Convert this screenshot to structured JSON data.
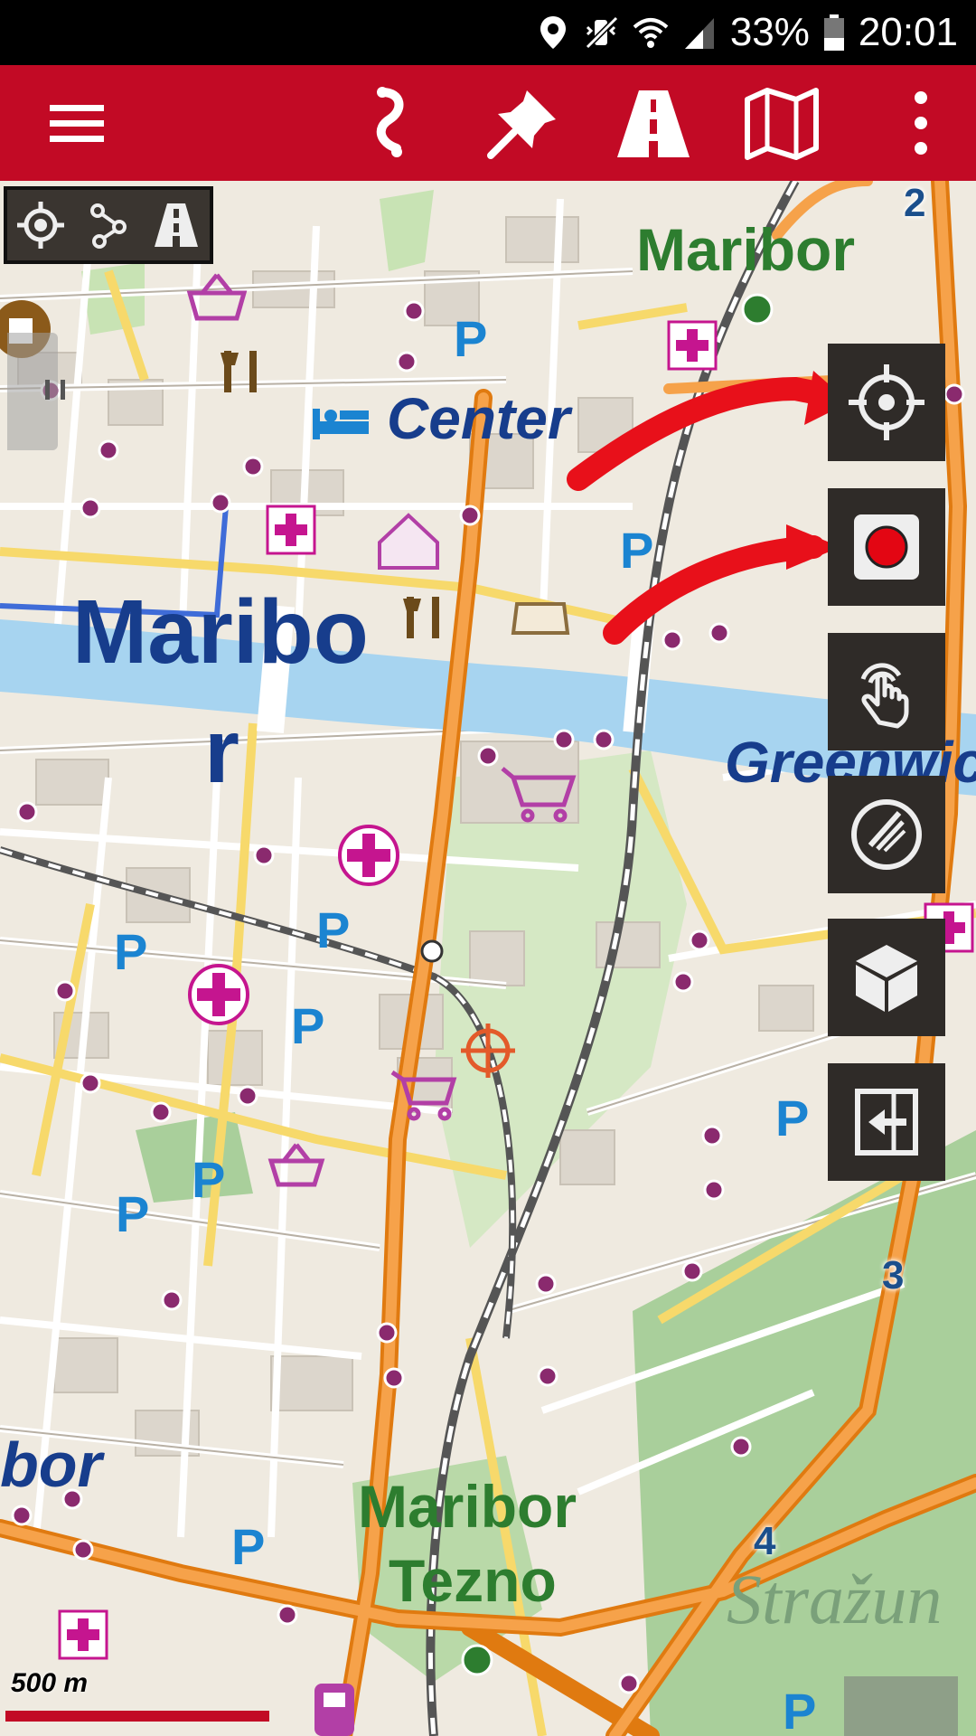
{
  "status_bar": {
    "icons": [
      "location-icon",
      "mute-vibrate-icon",
      "wifi-icon",
      "signal-icon",
      "battery-icon"
    ],
    "battery": "33%",
    "time": "20:01"
  },
  "app_bar": {
    "background_color": "#c20a25",
    "buttons": [
      "menu-icon",
      "route-icon",
      "pin-icon",
      "road-icon",
      "map-icon",
      "overflow-icon"
    ]
  },
  "mode_toolbar": {
    "items": [
      "gps-crosshair-icon",
      "share-nodes-icon",
      "road-mode-icon"
    ]
  },
  "tool_panel": {
    "items": [
      "gps-crosshair-icon",
      "record-icon",
      "touch-icon",
      "rotate-icon",
      "cube-3d-icon",
      "exit-panel-icon"
    ],
    "record_color": "#e30613"
  },
  "map": {
    "labels": {
      "city_main_1": "Maribo",
      "city_main_2": "r",
      "district_center": "Center",
      "district_greenwich": "Greenwic",
      "station_top": "Maribor",
      "station_bottom_1": "Maribor",
      "station_bottom_2": "Tezno",
      "city_left": "bor",
      "area_strazun": "Stražun"
    },
    "parking_label": "P",
    "route_numbers": [
      "2",
      "3",
      "4"
    ]
  },
  "scale": {
    "label": "500 m"
  }
}
